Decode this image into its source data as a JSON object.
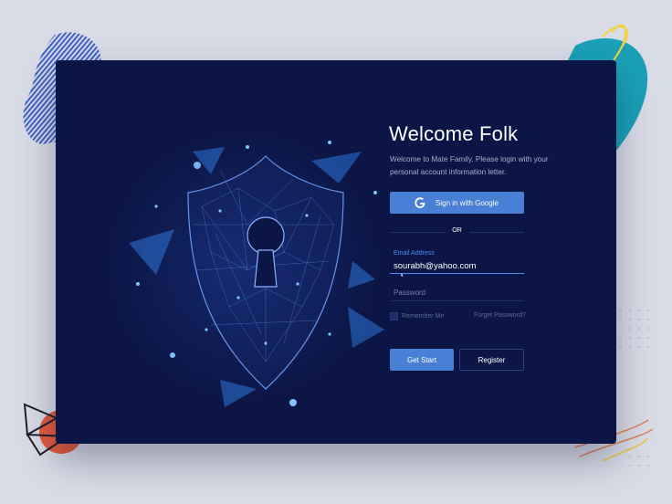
{
  "login": {
    "title": "Welcome Folk",
    "subtitle": "Welcome to Mate Family. Please login with your personal account information letter.",
    "google_button_label": "Sign in with Google",
    "divider_text": "OR",
    "email": {
      "label": "Email Address",
      "value": "sourabh@yahoo.com"
    },
    "password": {
      "placeholder": "Password"
    },
    "remember_label": "Remember Me",
    "forgot_label": "Forget Password?",
    "primary_button_label": "Get Start",
    "secondary_button_label": "Register"
  },
  "colors": {
    "card_background": "#0b1646",
    "accent": "#4a7fd6",
    "focus_underline": "#4d8cf5",
    "page_background": "#d9dbe6"
  },
  "icons": [
    "google-g-icon",
    "shield-keyhole-illustration"
  ]
}
